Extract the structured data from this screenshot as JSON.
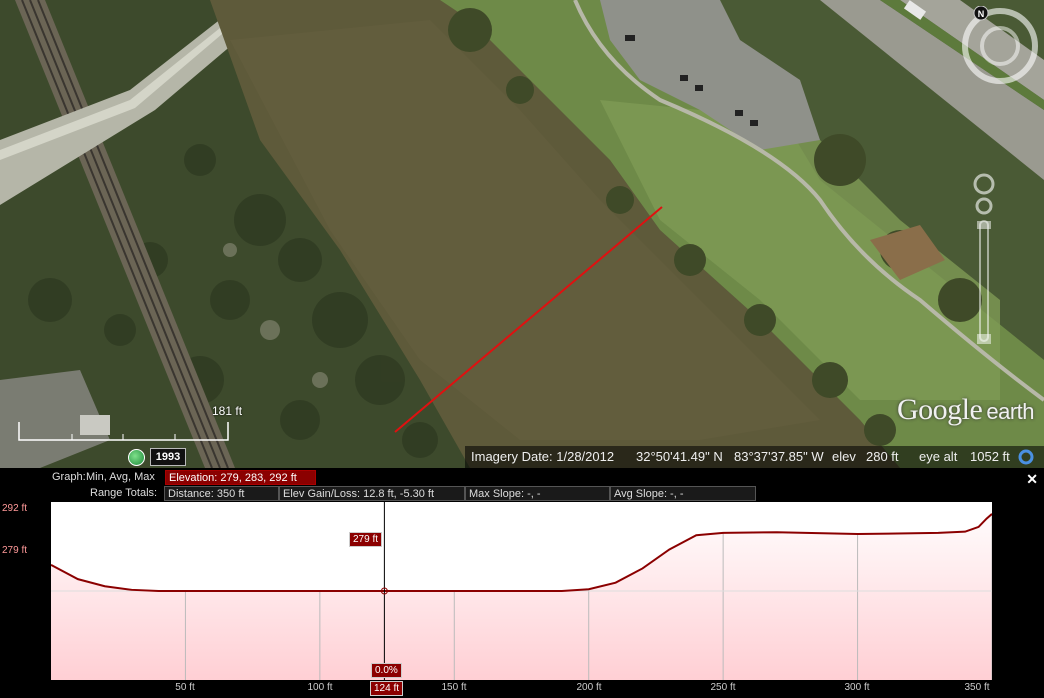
{
  "imagery": {
    "date_label": "Imagery Date: 1/28/2012",
    "latitude": "32°50'41.49\" N",
    "longitude": "83°37'37.85\" W",
    "elev_label": "elev",
    "elev_value": "280 ft",
    "eye_alt_label": "eye alt",
    "eye_alt_value": "1052 ft"
  },
  "map": {
    "scale_label": "181 ft",
    "historical_year": "1993",
    "north_label": "N",
    "logo_google": "Google",
    "logo_earth": "earth",
    "path_color": "#e01010"
  },
  "profile": {
    "graph_label": "Graph:",
    "graph_value": "Min, Avg, Max",
    "elevation_summary": "Elevation: 279, 283, 292 ft",
    "range_totals_label": "Range Totals:",
    "distance": "Distance: 350 ft",
    "elev_gain_loss": "Elev Gain/Loss: 12.8 ft, -5.30 ft",
    "max_slope": "Max Slope: -, -",
    "avg_slope": "Avg Slope: -, -",
    "close_glyph": "✕",
    "cursor_elev_tag": "279 ft",
    "cursor_slope_tag": "0.0%",
    "cursor_dist_tag": "124 ft"
  },
  "chart_data": {
    "type": "area",
    "x_unit": "ft",
    "y_unit": "ft",
    "xlim": [
      0,
      350
    ],
    "ylim": [
      264,
      294
    ],
    "y_ticks": [
      "292 ft",
      "279 ft"
    ],
    "x_ticks": [
      "50 ft",
      "100 ft",
      "150 ft",
      "200 ft",
      "250 ft",
      "300 ft",
      "350 ft"
    ],
    "cursor_x": 124,
    "cursor_y": 279,
    "series": [
      {
        "x": [
          0,
          10,
          20,
          30,
          40,
          60,
          100,
          150,
          190,
          200,
          210,
          220,
          230,
          240,
          250,
          270,
          300,
          330,
          340,
          345,
          348,
          350
        ],
        "y": [
          283.4,
          281.0,
          279.8,
          279.2,
          279.0,
          279.0,
          279.0,
          279.0,
          279.0,
          279.3,
          280.4,
          282.8,
          286.0,
          288.4,
          288.8,
          288.9,
          288.6,
          288.8,
          289.0,
          289.8,
          291.2,
          292.0
        ]
      }
    ],
    "colors": {
      "line": "#8b0000",
      "fill_top": "#ffffff",
      "fill_bottom": "#ffcfd4"
    }
  }
}
